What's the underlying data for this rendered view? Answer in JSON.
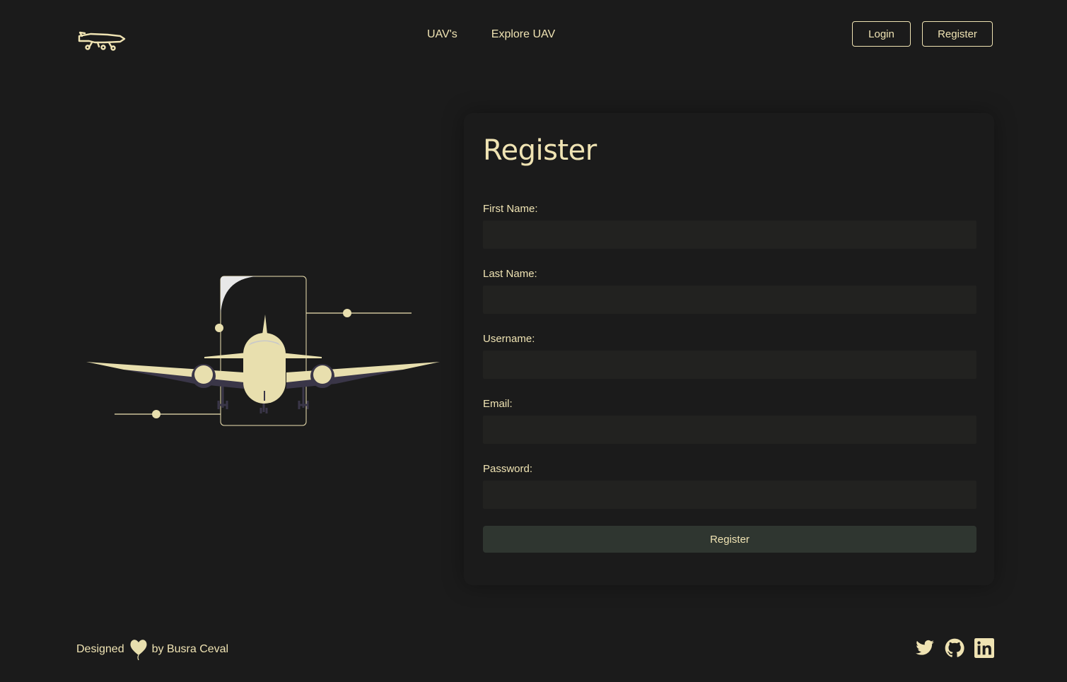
{
  "header": {
    "logo_icon": "uav-drone-icon",
    "nav": [
      {
        "label": "UAV's"
      },
      {
        "label": "Explore UAV"
      }
    ],
    "login_label": "Login",
    "register_label": "Register"
  },
  "illustration": {
    "icon": "airplane-illustration"
  },
  "form": {
    "title": "Register",
    "fields": [
      {
        "label": "First Name:",
        "value": ""
      },
      {
        "label": "Last Name:",
        "value": ""
      },
      {
        "label": "Username:",
        "value": ""
      },
      {
        "label": "Email:",
        "value": ""
      },
      {
        "label": "Password:",
        "value": ""
      }
    ],
    "submit_label": "Register"
  },
  "footer": {
    "designed_text": "Designed",
    "by_text": "by Busra Ceval",
    "heart_icon": "heart-balloon-icon",
    "social": [
      {
        "icon": "twitter-icon"
      },
      {
        "icon": "github-icon"
      },
      {
        "icon": "linkedin-icon"
      }
    ]
  },
  "colors": {
    "background": "#1b1b1b",
    "accent": "#efe3b3",
    "input_bg": "#222220",
    "button_bg": "#2f3630"
  }
}
